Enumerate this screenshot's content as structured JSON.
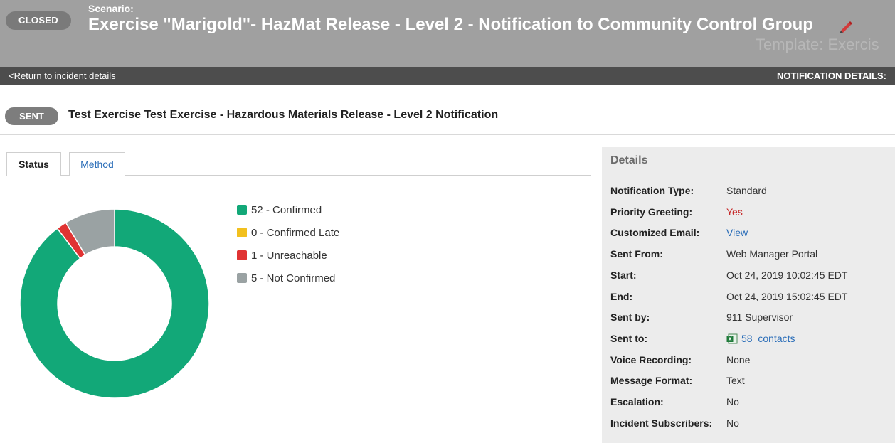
{
  "header": {
    "status_badge": "CLOSED",
    "scenario_label": "Scenario:",
    "scenario_title": "Exercise \"Marigold\"- HazMat Release - Level 2 - Notification to Community Control Group",
    "edit_icon": "pencil-icon",
    "template_text": "Template: Exercis"
  },
  "subbar": {
    "return_link": "<Return to incident details",
    "section_label": "NOTIFICATION DETAILS:"
  },
  "notification": {
    "status_badge": "SENT",
    "title": "Test Exercise Test Exercise - Hazardous Materials Release - Level 2 Notification"
  },
  "tabs": [
    {
      "label": "Status",
      "active": true
    },
    {
      "label": "Method",
      "active": false
    }
  ],
  "chart_data": {
    "type": "pie",
    "categories": [
      "Confirmed",
      "Confirmed Late",
      "Unreachable",
      "Not Confirmed"
    ],
    "values": [
      52,
      0,
      1,
      5
    ],
    "colors": [
      "#12a878",
      "#f2c01e",
      "#e03333",
      "#9aa2a3"
    ],
    "legend_labels": [
      "52 - Confirmed",
      "0 - Confirmed Late",
      "1 - Unreachable",
      "5 - Not Confirmed"
    ],
    "legend_position": "right"
  },
  "details": {
    "title": "Details",
    "rows": [
      {
        "label": "Notification Type:",
        "value": "Standard"
      },
      {
        "label": "Priority Greeting:",
        "value": "Yes"
      },
      {
        "label": "Customized Email:",
        "value": "View"
      },
      {
        "label": "Sent From:",
        "value": "Web Manager Portal"
      },
      {
        "label": "Start:",
        "value": "Oct 24, 2019 10:02:45 EDT"
      },
      {
        "label": "End:",
        "value": "Oct 24, 2019 15:02:45 EDT"
      },
      {
        "label": "Sent by:",
        "value": "911 Supervisor"
      },
      {
        "label": "Sent to:",
        "value": "58  contacts",
        "icon": "excel-icon"
      },
      {
        "label": "Voice Recording:",
        "value": "None"
      },
      {
        "label": "Message Format:",
        "value": "Text"
      },
      {
        "label": "Escalation:",
        "value": "No"
      },
      {
        "label": "Incident Subscribers:",
        "value": "No"
      }
    ]
  }
}
